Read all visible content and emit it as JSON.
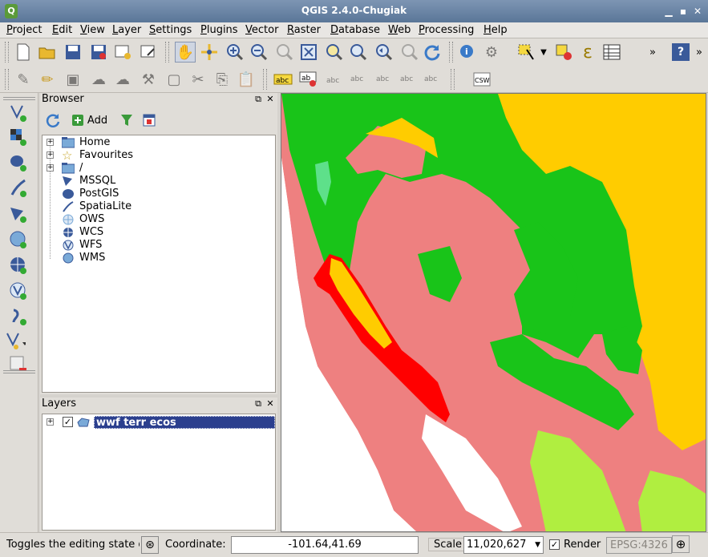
{
  "window": {
    "title": "QGIS 2.4.0-Chugiak",
    "icon": "qgis-icon"
  },
  "menu": [
    "Project",
    "Edit",
    "View",
    "Layer",
    "Settings",
    "Plugins",
    "Vector",
    "Raster",
    "Database",
    "Web",
    "Processing",
    "Help"
  ],
  "browser": {
    "title": "Browser",
    "add_label": "Add",
    "items": [
      {
        "label": "Home",
        "icon": "folder-icon",
        "expandable": true
      },
      {
        "label": "Favourites",
        "icon": "star-icon",
        "expandable": true
      },
      {
        "label": "/",
        "icon": "folder-icon",
        "expandable": true
      },
      {
        "label": "MSSQL",
        "icon": "mssql-icon",
        "expandable": false
      },
      {
        "label": "PostGIS",
        "icon": "postgis-icon",
        "expandable": false
      },
      {
        "label": "SpatiaLite",
        "icon": "spatialite-icon",
        "expandable": false
      },
      {
        "label": "OWS",
        "icon": "globe-icon",
        "expandable": false
      },
      {
        "label": "WCS",
        "icon": "wcs-icon",
        "expandable": false
      },
      {
        "label": "WFS",
        "icon": "wfs-icon",
        "expandable": false
      },
      {
        "label": "WMS",
        "icon": "wms-icon",
        "expandable": false
      }
    ]
  },
  "layers": {
    "title": "Layers",
    "items": [
      {
        "name": "wwf terr ecos",
        "checked": true
      }
    ]
  },
  "status": {
    "message": "Toggles the editing state of the current layer",
    "coordinate_label": "Coordinate:",
    "coordinate_value": "-101.64,41.69",
    "scale_label": "Scale",
    "scale_value": "11,020,627",
    "render_label": "Render",
    "render_checked": true,
    "crs": "EPSG:4326",
    "check_mark": "✓"
  },
  "colors": {
    "titlebar": "#5a7698",
    "selection": "#2b3f8e",
    "map_green": "#19c419",
    "map_pink": "#ee8080",
    "map_yellow": "#ffcc00",
    "map_red": "#ff0000",
    "map_lime": "#b0ee40"
  }
}
